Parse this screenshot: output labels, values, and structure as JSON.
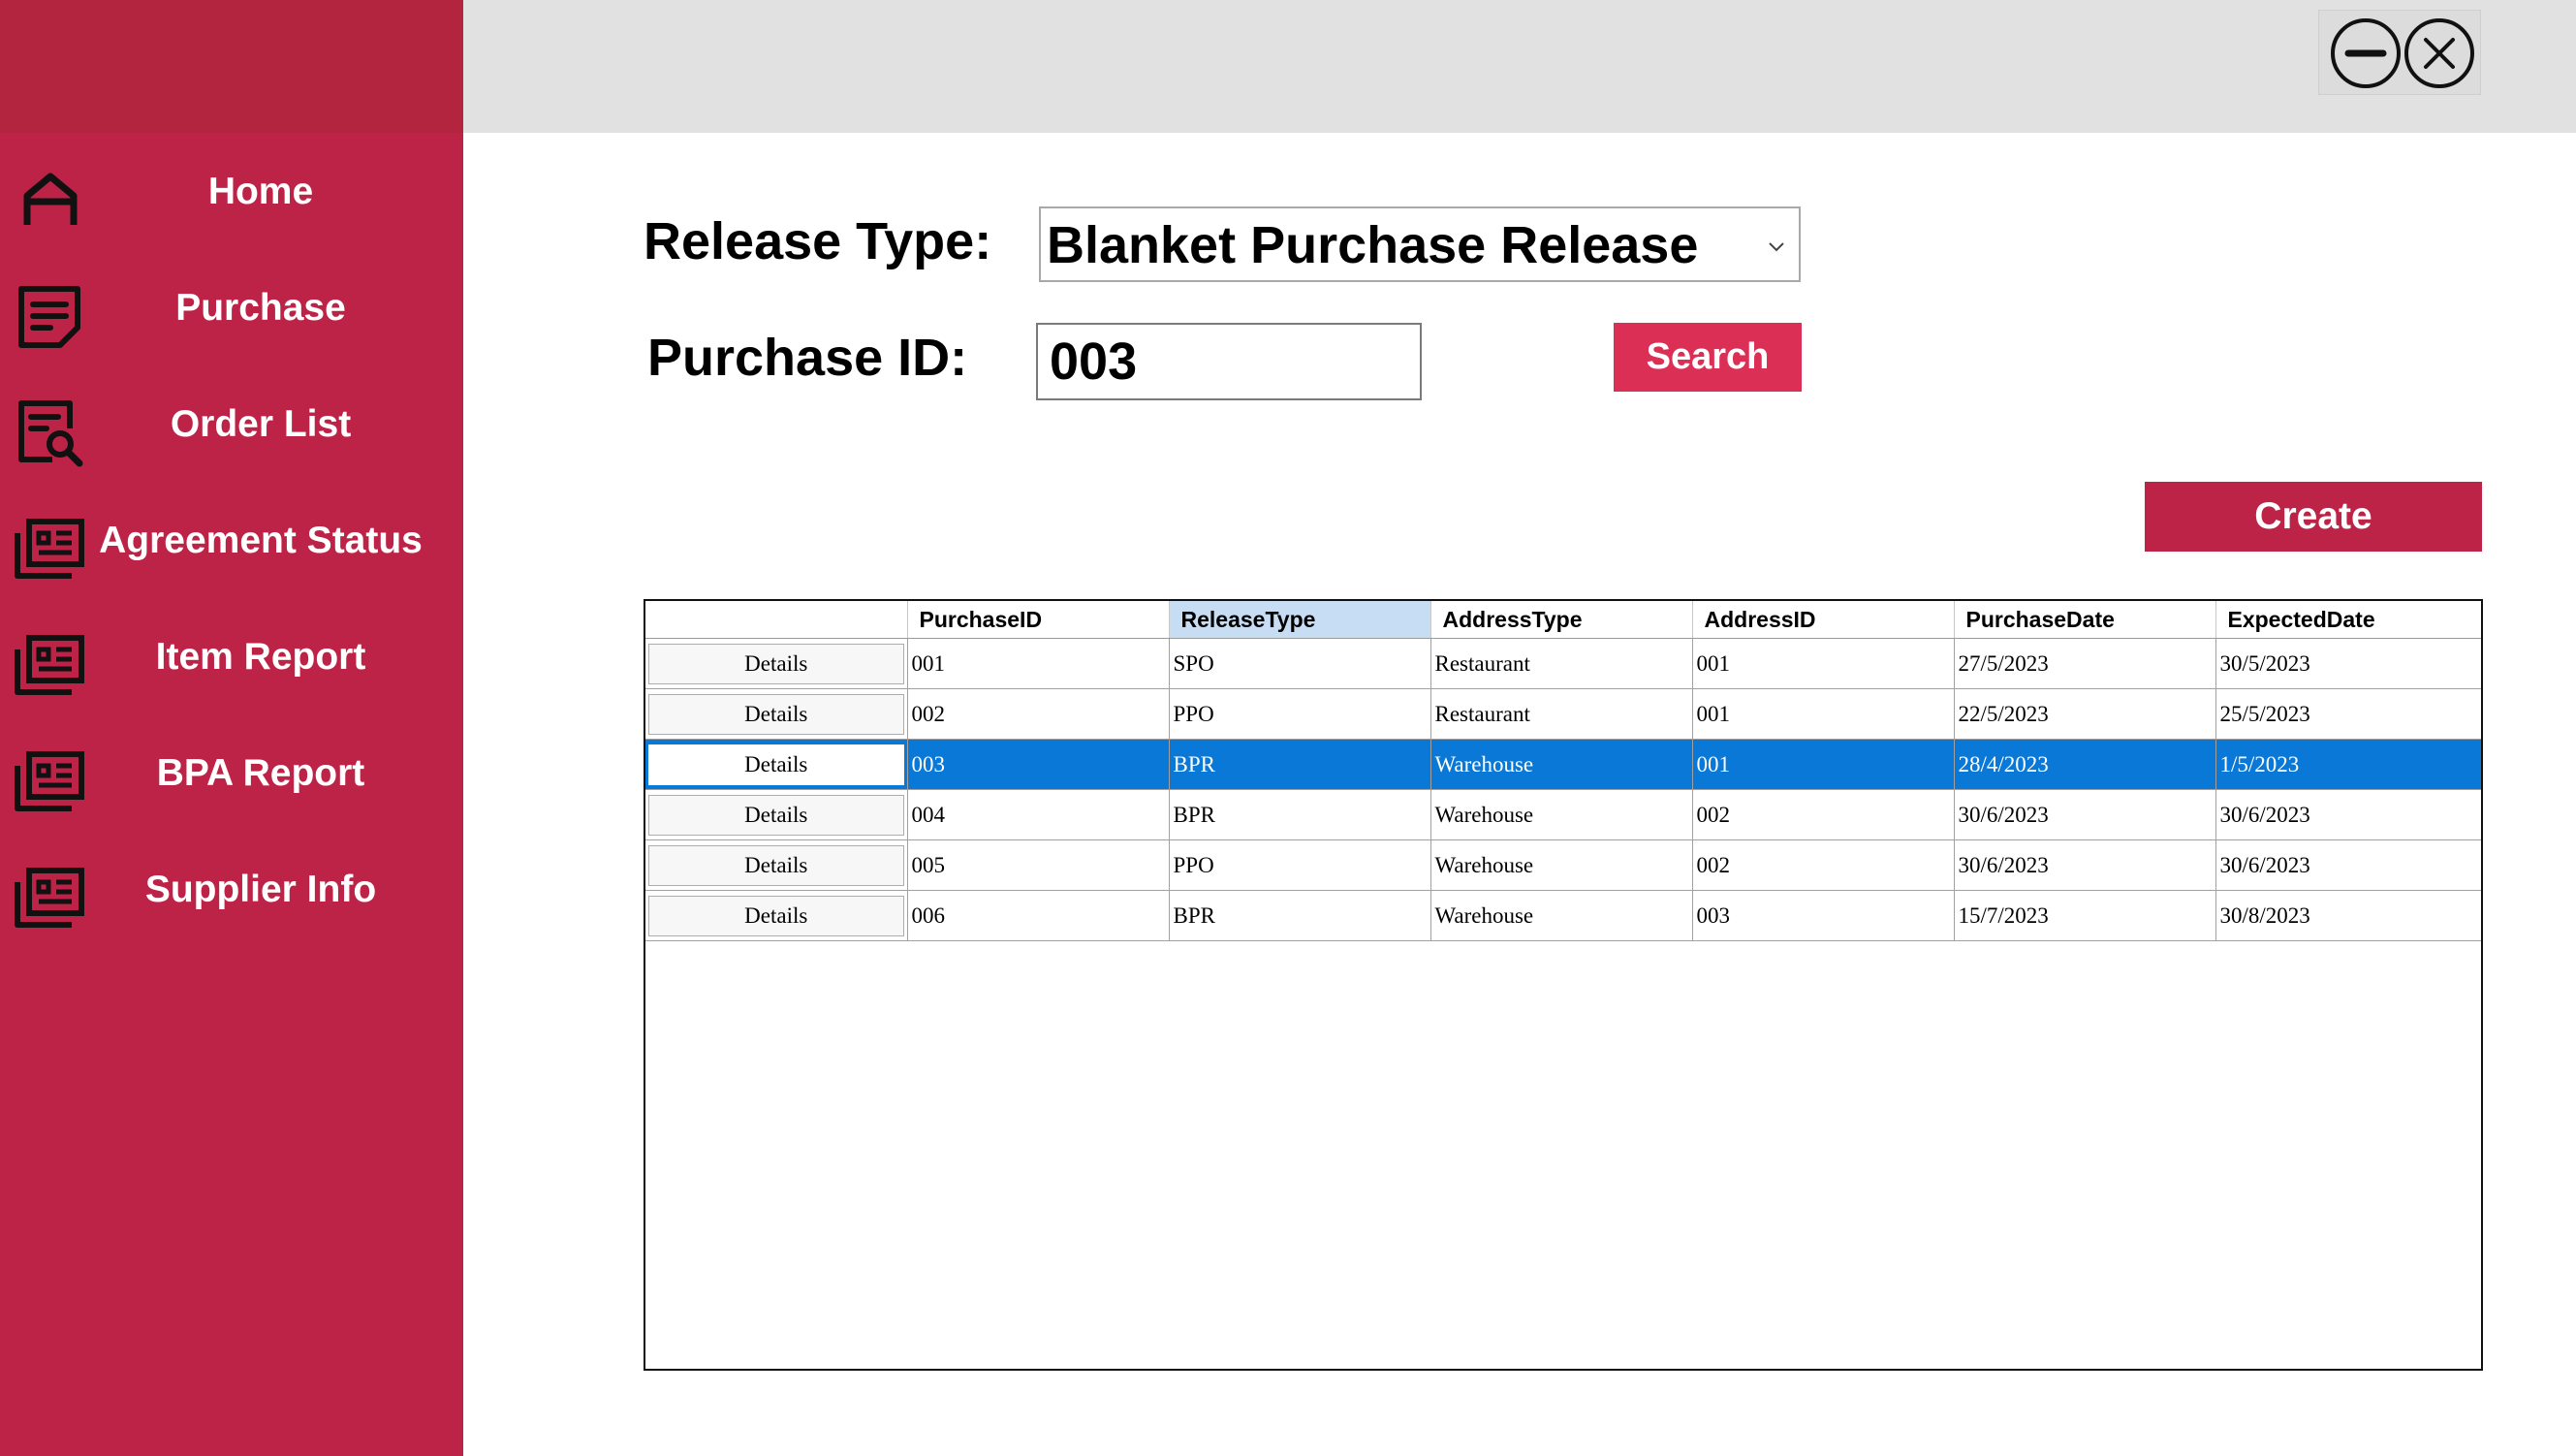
{
  "colors": {
    "sidebar": "#bd2346",
    "accent_button": "#dc2f55",
    "create_button": "#bd2346",
    "selected_row": "#0a78d6"
  },
  "sidebar": {
    "items": [
      {
        "label": "Home",
        "icon": "home-icon"
      },
      {
        "label": "Purchase",
        "icon": "document-icon"
      },
      {
        "label": "Order List",
        "icon": "search-document-icon"
      },
      {
        "label": "Agreement Status",
        "icon": "report-icon"
      },
      {
        "label": "Item Report",
        "icon": "report-icon"
      },
      {
        "label": "BPA Report",
        "icon": "report-icon"
      },
      {
        "label": "Supplier Info",
        "icon": "report-icon"
      }
    ]
  },
  "window_controls": {
    "minimize_icon": "minimize-icon",
    "close_icon": "close-icon"
  },
  "form": {
    "release_type_label": "Release Type:",
    "release_type_value": "Blanket Purchase Release",
    "purchase_id_label": "Purchase ID:",
    "purchase_id_value": "003",
    "search_label": "Search",
    "create_label": "Create"
  },
  "grid": {
    "columns": [
      "",
      "PurchaseID",
      "ReleaseType",
      "AddressType",
      "AddressID",
      "PurchaseDate",
      "ExpectedDate"
    ],
    "sorted_column": "ReleaseType",
    "button_label": "Details",
    "selected_row": 2,
    "rows": [
      [
        "Details",
        "001",
        "SPO",
        "Restaurant",
        "001",
        "27/5/2023",
        "30/5/2023"
      ],
      [
        "Details",
        "002",
        "PPO",
        "Restaurant",
        "001",
        "22/5/2023",
        "25/5/2023"
      ],
      [
        "Details",
        "003",
        "BPR",
        "Warehouse",
        "001",
        "28/4/2023",
        "1/5/2023"
      ],
      [
        "Details",
        "004",
        "BPR",
        "Warehouse",
        "002",
        "30/6/2023",
        "30/6/2023"
      ],
      [
        "Details",
        "005",
        "PPO",
        "Warehouse",
        "002",
        "30/6/2023",
        "30/6/2023"
      ],
      [
        "Details",
        "006",
        "BPR",
        "Warehouse",
        "003",
        "15/7/2023",
        "30/8/2023"
      ]
    ]
  }
}
